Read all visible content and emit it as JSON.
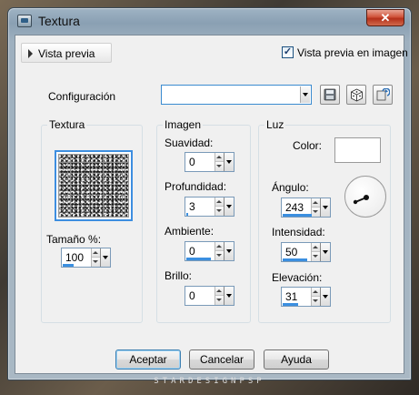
{
  "window": {
    "title": "Textura",
    "close_glyph": "✕"
  },
  "preview": {
    "toggle_label": "Vista previa",
    "checkbox_label": "Vista previa en imagen",
    "checkbox_checked": true
  },
  "config": {
    "label": "Configuración",
    "value": ""
  },
  "groups": {
    "texture": {
      "title": "Textura",
      "size_label": "Tamaño %:",
      "size_value": "100"
    },
    "image": {
      "title": "Imagen",
      "fields": [
        {
          "label": "Suavidad:",
          "value": "0"
        },
        {
          "label": "Profundidad:",
          "value": "3"
        },
        {
          "label": "Ambiente:",
          "value": "0"
        },
        {
          "label": "Brillo:",
          "value": "0"
        }
      ]
    },
    "light": {
      "title": "Luz",
      "color_label": "Color:",
      "color_value": "#ffffff",
      "angle_label": "Ángulo:",
      "angle_value": "243",
      "intensity_label": "Intensidad:",
      "intensity_value": "50",
      "elevation_label": "Elevación:",
      "elevation_value": "31"
    }
  },
  "buttons": {
    "ok": "Aceptar",
    "cancel": "Cancelar",
    "help": "Ayuda"
  },
  "watermark": "STARDESIGNPSP"
}
